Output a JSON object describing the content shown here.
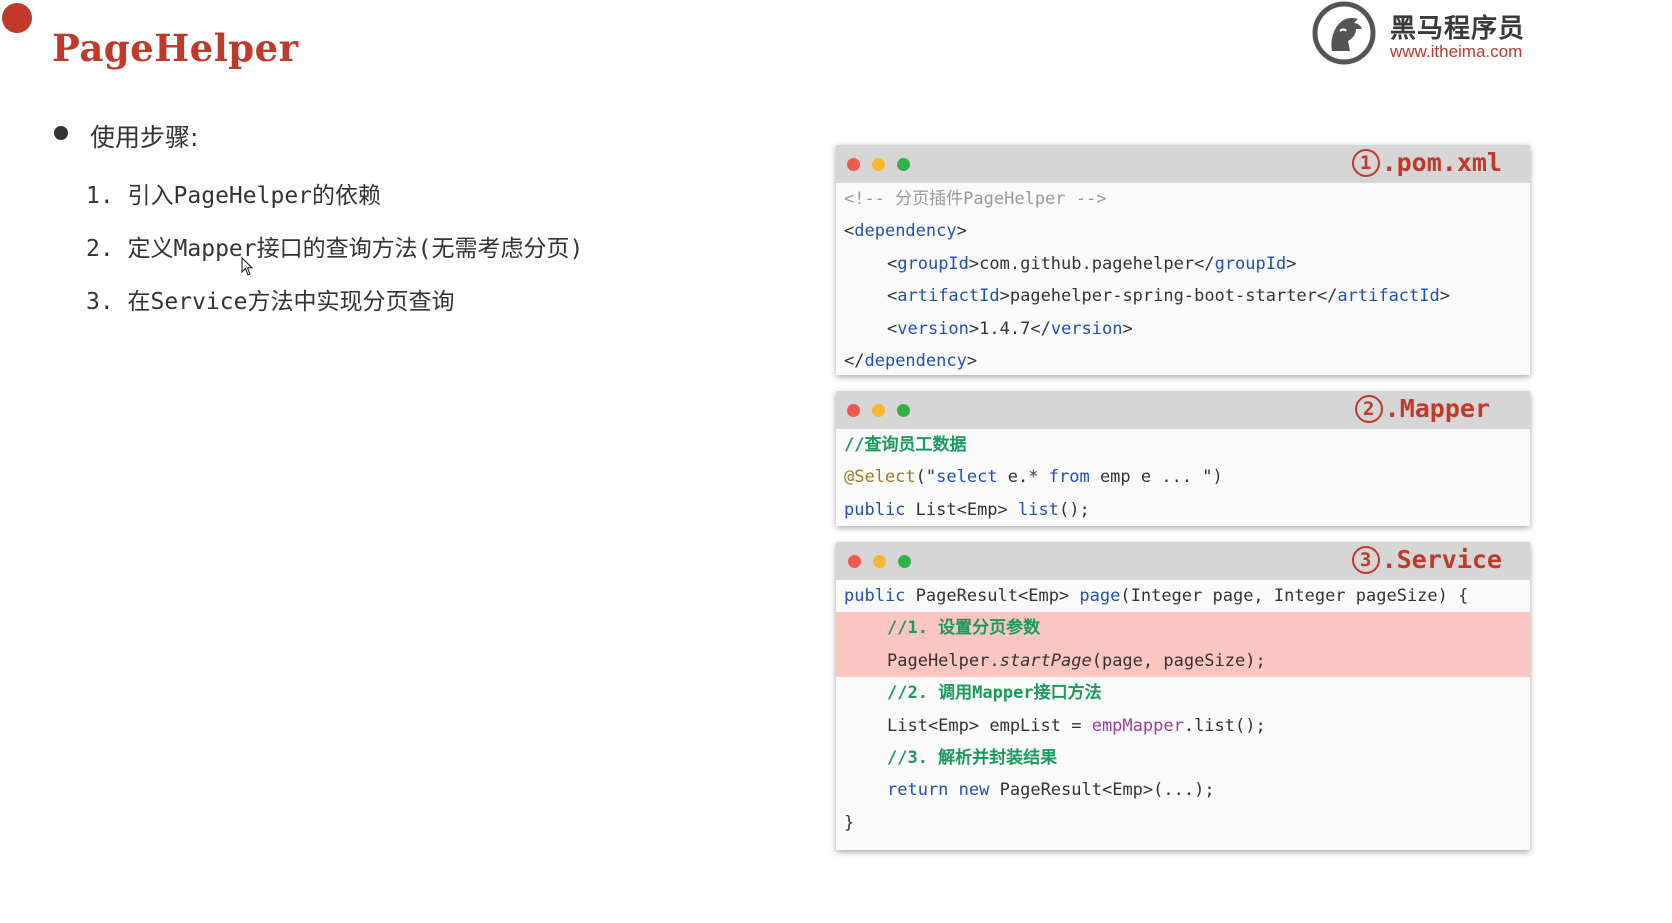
{
  "slide": {
    "title": "PageHelper",
    "steps_heading": "使用步骤:",
    "steps": [
      "1.  引入PageHelper的依赖",
      "2.  定义Mapper接口的查询方法(无需考虑分页)",
      "3.  在Service方法中实现分页查询"
    ]
  },
  "logo": {
    "name_cn": "黑马程序员",
    "url": "www.itheima.com"
  },
  "windows": {
    "pom": {
      "num": "1",
      "title": ".pom.xml",
      "comment": "<!-- 分页插件PageHelper -->",
      "dep_open": "dependency",
      "group_tag": "groupId",
      "group_val": "com.github.pagehelper",
      "artifact_tag": "artifactId",
      "artifact_val": "pagehelper-spring-boot-starter",
      "version_tag": "version",
      "version_val": "1.4.7",
      "dep_close": "dependency"
    },
    "mapper": {
      "num": "2",
      "title": ".Mapper",
      "comment": "//查询员工数据",
      "annotation": "@Select",
      "sql_select": "select",
      "sql_mid": " e.* ",
      "sql_from": "from",
      "sql_rest": " emp e ... ",
      "kw_public": "public",
      "ret_type": " List<Emp> ",
      "method": "list",
      "tail": "();"
    },
    "service": {
      "num": "3",
      "title": ".Service",
      "kw_public": "public",
      "sig_type": " PageResult<Emp> ",
      "sig_method": "page",
      "sig_params": "(Integer page, Integer pageSize) {",
      "c1": "//1. 设置分页参数",
      "l2_obj": "PageHelper.",
      "l2_method": "startPage",
      "l2_args": "(page, pageSize);",
      "c2": "//2. 调用Mapper接口方法",
      "l4_left": "List<Emp> empList = ",
      "l4_obj": "empMapper",
      "l4_right": ".list();",
      "c3": "//3. 解析并封装结果",
      "kw_return": "return",
      "kw_new": "new",
      "l6_rest": " PageResult<Emp>(...);",
      "close": "}"
    }
  },
  "colors": {
    "accent_red": "#c0392b",
    "highlight": "#fbc6c0",
    "keyword_blue": "#1f4fb8",
    "comment_green": "#1c9a5c"
  },
  "icons": [
    "horse-logo-icon",
    "mouse-cursor-icon",
    "traffic-light-icons"
  ]
}
